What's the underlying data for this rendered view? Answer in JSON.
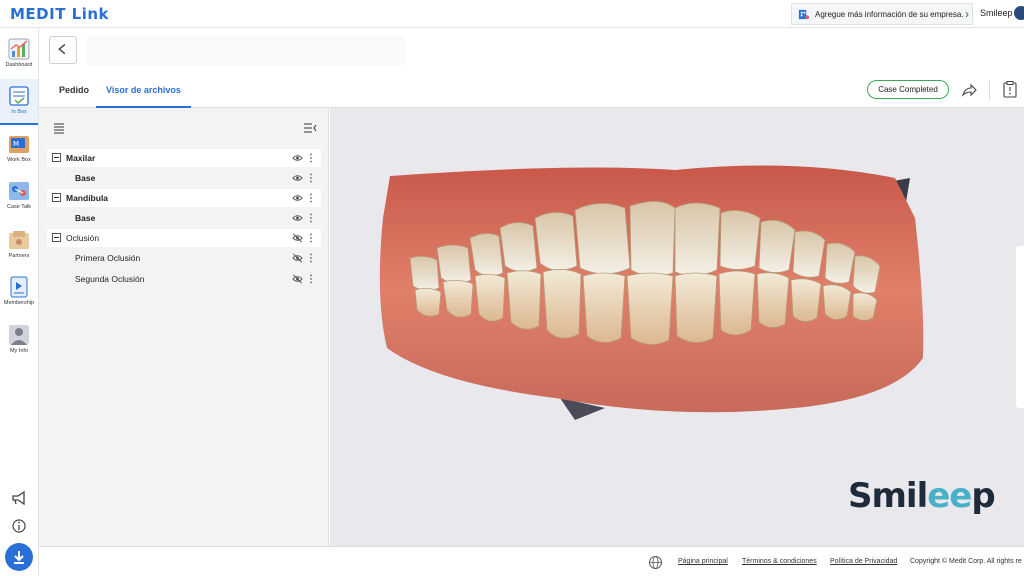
{
  "app": {
    "title": "MEDIT Link"
  },
  "topbar": {
    "notice": "Agregue más información de su empresa.",
    "user": "Smileep"
  },
  "sidebar": {
    "items": [
      {
        "label": "Dashboard",
        "icon": "dashboard-chart-icon"
      },
      {
        "label": "In Box",
        "icon": "inbox-icon",
        "active": true
      },
      {
        "label": "Work Box",
        "icon": "workbox-icon"
      },
      {
        "label": "Case Talk",
        "icon": "case-talk-icon"
      },
      {
        "label": "Partners",
        "icon": "partners-icon"
      },
      {
        "label": "Membership",
        "icon": "membership-icon"
      },
      {
        "label": "My Info",
        "icon": "my-info-icon"
      }
    ]
  },
  "header": {
    "tabs": [
      {
        "label": "Pedido"
      },
      {
        "label": "Visor de archivos",
        "active": true
      }
    ],
    "case_status": "Case Completed"
  },
  "panel": {
    "rows": [
      {
        "label": "Maxilar",
        "type": "group",
        "bold": true,
        "visible": true
      },
      {
        "label": "Base",
        "type": "child",
        "bold": true,
        "visible": true
      },
      {
        "label": "Mandíbula",
        "type": "group",
        "bold": true,
        "visible": true
      },
      {
        "label": "Base",
        "type": "child",
        "bold": true,
        "visible": true
      },
      {
        "label": "Oclusión",
        "type": "group",
        "bold": false,
        "visible": false
      },
      {
        "label": "Primera Oclusión",
        "type": "child",
        "bold": false,
        "visible": false
      },
      {
        "label": "Segunda Oclusión",
        "type": "child",
        "bold": false,
        "visible": false
      }
    ]
  },
  "viewer": {
    "brand_prefix": "Smil",
    "brand_ee": "ee",
    "brand_suffix": "p"
  },
  "footer": {
    "links": [
      "Página principal",
      "Términos & condiciones",
      "Política de Privacidad"
    ],
    "copyright": "Copyright © Medit Corp. All rights re"
  },
  "colors": {
    "accent": "#2a6fd8",
    "case_completed_border": "#3aaa5a",
    "viewer_bg": "#e9e9ed"
  }
}
